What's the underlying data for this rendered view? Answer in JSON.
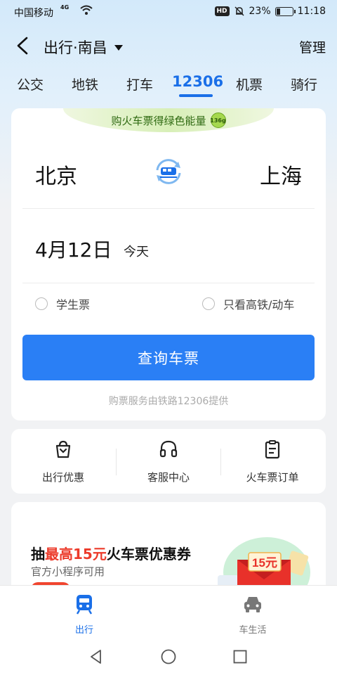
{
  "status_bar": {
    "carrier": "中国移动",
    "network": "4G",
    "hd": "HD",
    "battery_percent": "23%",
    "battery_level": 0.23,
    "time": "11:18"
  },
  "header": {
    "title": "出行·南昌",
    "manage_label": "管理"
  },
  "tabs": [
    {
      "label": "公交",
      "active": false
    },
    {
      "label": "地铁",
      "active": false
    },
    {
      "label": "打车",
      "active": false
    },
    {
      "label": "12306",
      "active": true
    },
    {
      "label": "机票",
      "active": false
    },
    {
      "label": "骑行",
      "active": false
    }
  ],
  "booking": {
    "banner_text": "购火车票得绿色能量",
    "energy_badge": "136g",
    "from_station": "北京",
    "to_station": "上海",
    "date": "4月12日",
    "date_hint": "今天",
    "option_student": "学生票",
    "option_highspeed": "只看高铁/动车",
    "query_button": "查询车票",
    "provider_note": "购票服务由铁路12306提供"
  },
  "services": [
    {
      "label": "出行优惠",
      "icon": "gift-bag-icon"
    },
    {
      "label": "客服中心",
      "icon": "headset-icon"
    },
    {
      "label": "火车票订单",
      "icon": "clipboard-icon"
    }
  ],
  "promo": {
    "title_prefix": "抽",
    "title_highlight": "最高15元",
    "title_suffix": "火车票优惠券",
    "subtitle": "官方小程序可用",
    "coupon_value": "15元"
  },
  "bottom_nav": [
    {
      "label": "出行",
      "icon": "train-icon",
      "active": true
    },
    {
      "label": "车生活",
      "icon": "car-icon",
      "active": false
    }
  ],
  "colors": {
    "accent": "#1a6fe8",
    "button": "#2a7ff5",
    "promo_red": "#ec3a2a"
  }
}
